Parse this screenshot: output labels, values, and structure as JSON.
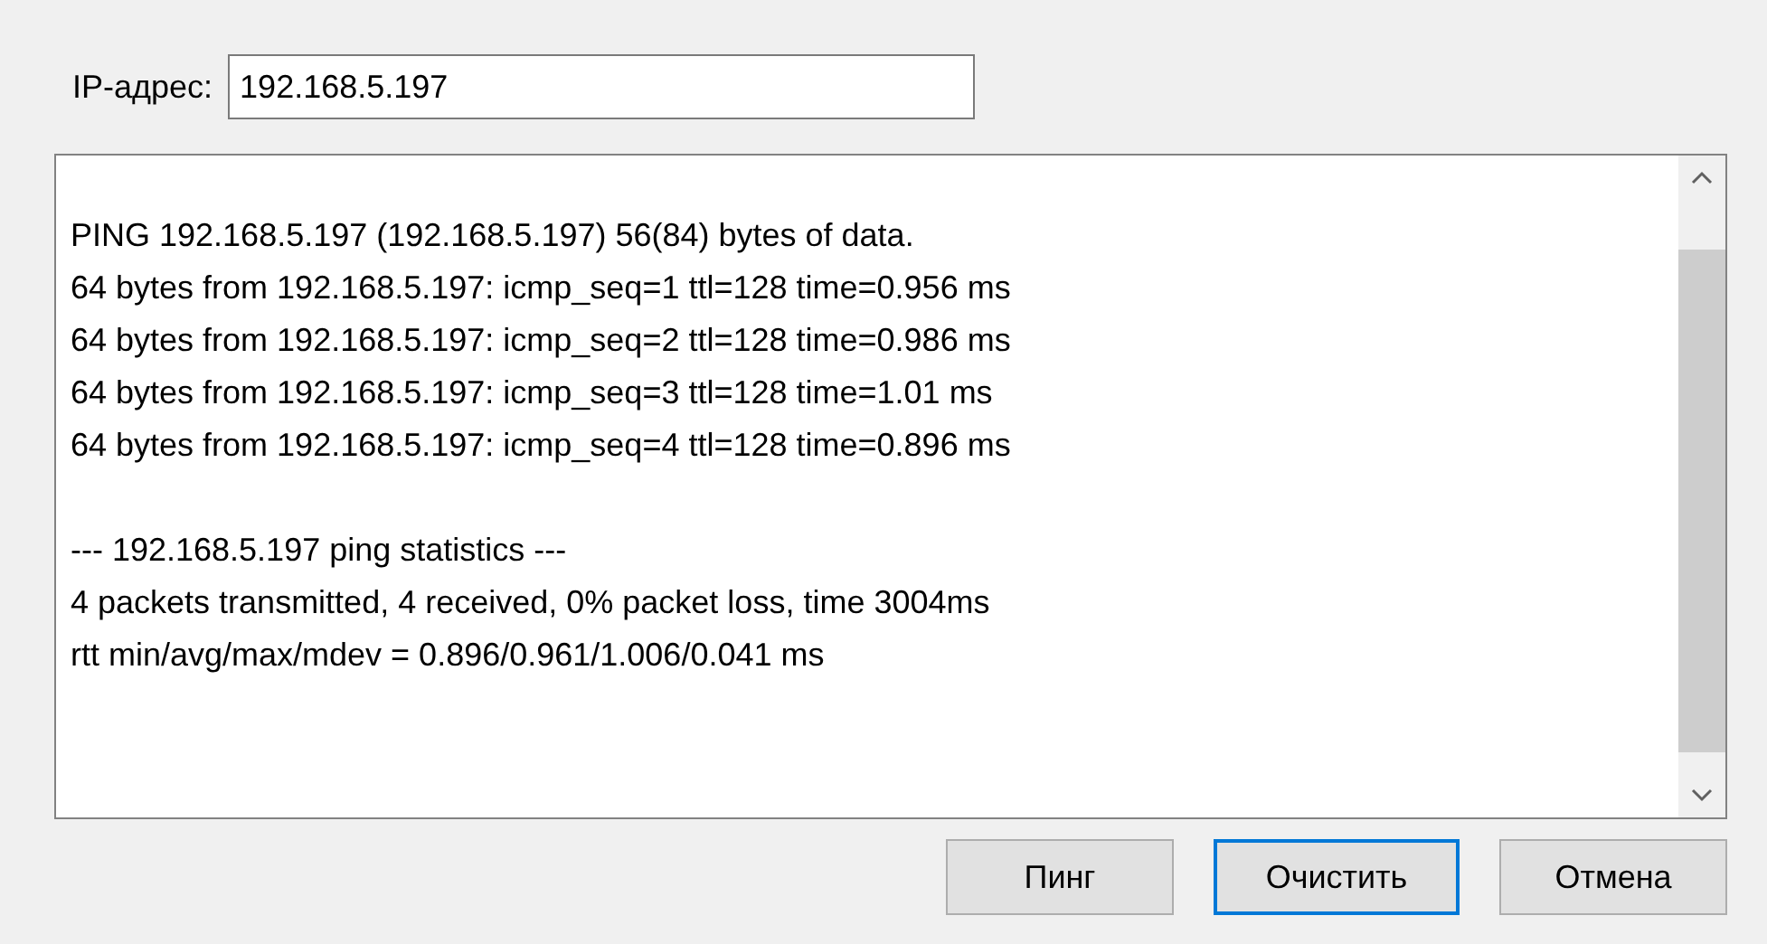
{
  "ip_field": {
    "label": "IP-адрес:",
    "value": "192.168.5.197"
  },
  "output_blocks": [
    [
      "PING 192.168.5.197 (192.168.5.197) 56(84) bytes of data.",
      "64 bytes from 192.168.5.197: icmp_seq=1 ttl=128 time=0.956 ms",
      "64 bytes from 192.168.5.197: icmp_seq=2 ttl=128 time=0.986 ms",
      "64 bytes from 192.168.5.197: icmp_seq=3 ttl=128 time=1.01 ms",
      "64 bytes from 192.168.5.197: icmp_seq=4 ttl=128 time=0.896 ms"
    ],
    [
      "--- 192.168.5.197 ping statistics ---",
      "4 packets transmitted, 4 received, 0% packet loss, time 3004ms",
      "rtt min/avg/max/mdev = 0.896/0.961/1.006/0.041 ms"
    ]
  ],
  "buttons": [
    {
      "label": "Пинг",
      "focused": false
    },
    {
      "label": "Очистить",
      "focused": true
    },
    {
      "label": "Отмена",
      "focused": false
    }
  ]
}
